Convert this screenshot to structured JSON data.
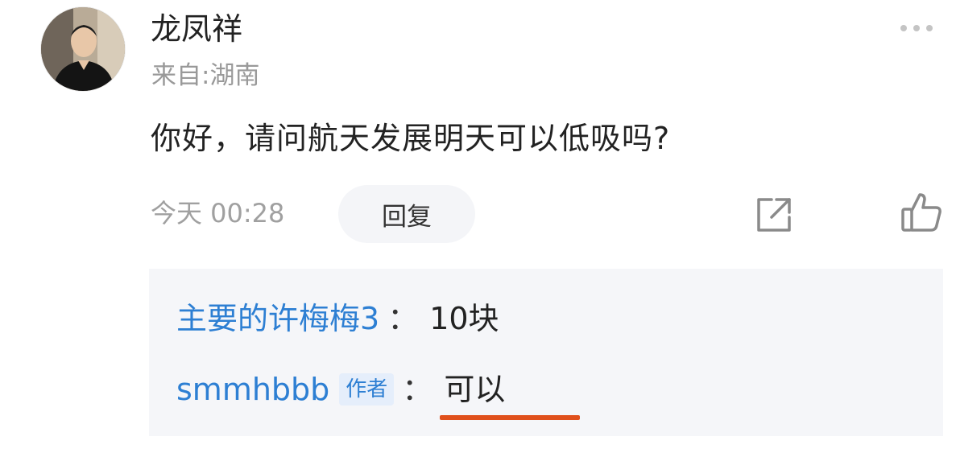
{
  "comment": {
    "username": "龙凤祥",
    "location": "来自:湖南",
    "text": "你好，请问航天发展明天可以低吸吗?",
    "timestamp": "今天 00:28",
    "reply_label": "回复",
    "icons": {
      "more": "more-icon",
      "share": "share-icon",
      "like": "thumbs-up-icon"
    }
  },
  "replies": [
    {
      "user": "主要的许梅梅3",
      "colon": "：",
      "text": "10块",
      "badge": ""
    },
    {
      "user": "smmhbbb",
      "badge": "作者",
      "colon": "：",
      "text": "可以"
    }
  ],
  "colors": {
    "link_blue": "#2d7fd3",
    "highlight_underline": "#e0501c",
    "reply_bg": "#f5f6f9"
  }
}
